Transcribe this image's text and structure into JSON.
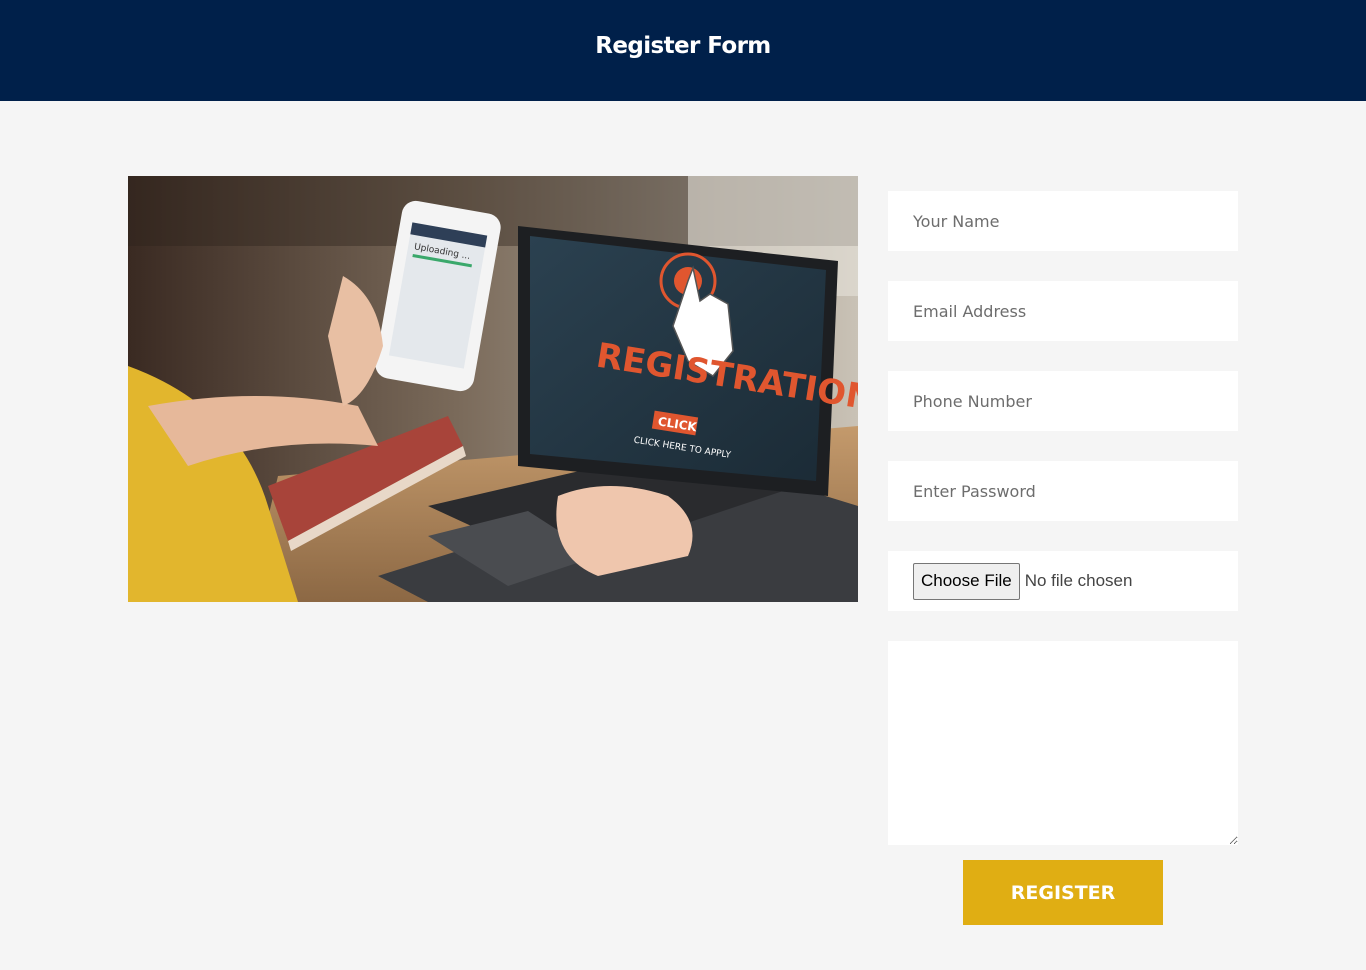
{
  "header": {
    "title": "Register Form"
  },
  "hero": {
    "phone_text": "Uploading ...",
    "screen_title": "REGISTRATION",
    "screen_button": "CLICK",
    "screen_subtitle": "CLICK HERE TO APPLY"
  },
  "form": {
    "name_placeholder": "Your Name",
    "email_placeholder": "Email Address",
    "phone_placeholder": "Phone Number",
    "password_placeholder": "Enter Password",
    "file_button": "Choose File",
    "file_status": "No file chosen",
    "message_value": "",
    "register_label": "REGISTER"
  },
  "colors": {
    "header_bg": "#00204a",
    "page_bg": "#f5f5f5",
    "button_bg": "#e0ae13",
    "field_bg": "#ffffff"
  }
}
